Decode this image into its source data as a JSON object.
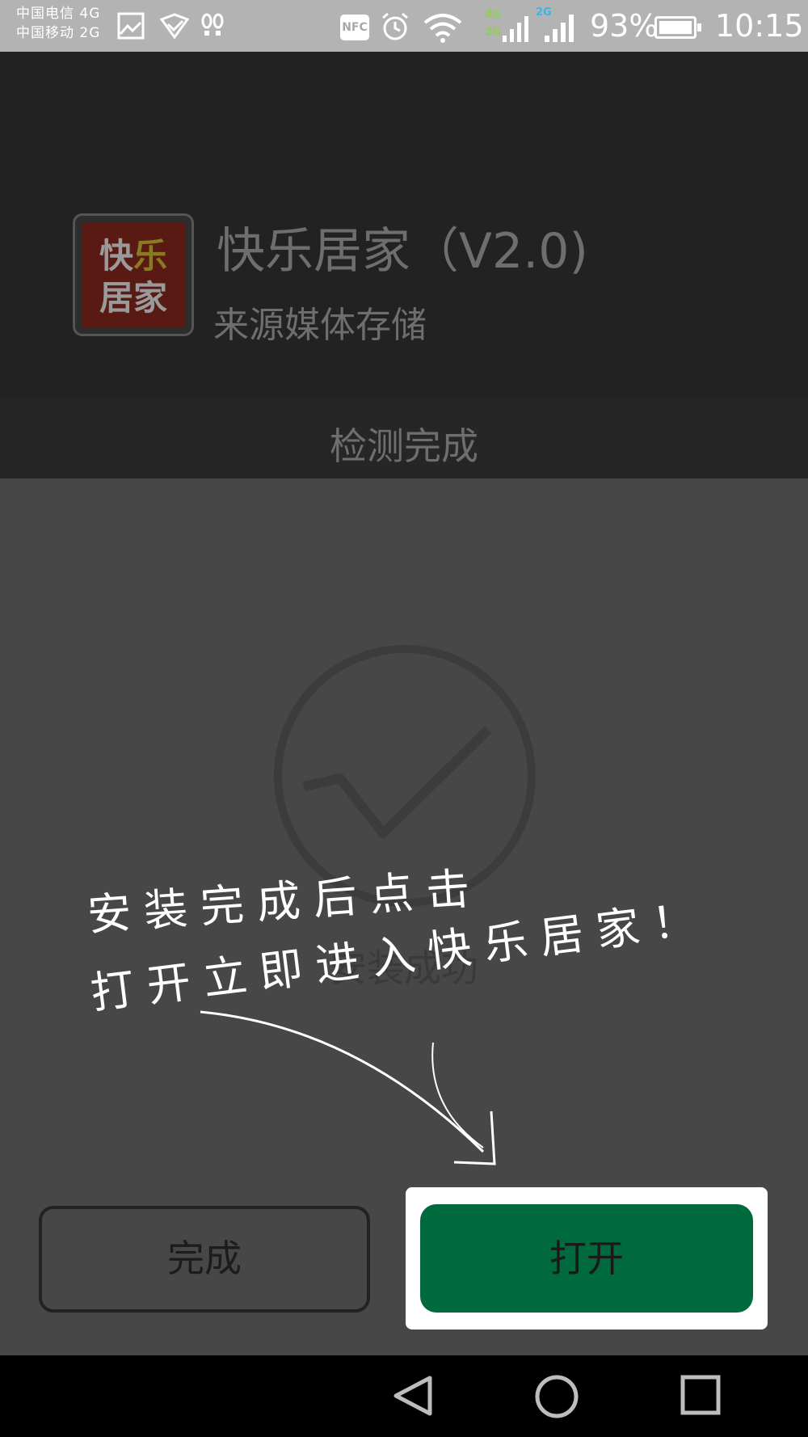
{
  "status_bar": {
    "carrier_1": "中国电信 4G",
    "carrier_2": "中国移动 2G",
    "nfc": "NFC",
    "net_4g": "4G",
    "net_2g_a": "2G",
    "net_2g_b": "2G",
    "battery_percent": "93%",
    "battery_level": 0.93,
    "time": "10:15",
    "icons": [
      "gallery-icon",
      "shield-icon",
      "footprints-icon",
      "nfc-icon",
      "alarm-icon",
      "wifi-icon",
      "signal-icon",
      "battery-icon"
    ]
  },
  "app": {
    "logo_text_line1": "快乐",
    "logo_text_line2": "居家",
    "name": "快乐居家（V2.0)",
    "source": "来源媒体存储"
  },
  "detection": {
    "status": "检测完成"
  },
  "result": {
    "icon": "checkmark-circle-icon",
    "text": "安装成功"
  },
  "hint": {
    "line1": "安装完成后点击",
    "line2": "打开立即进入快乐居家！"
  },
  "buttons": {
    "done": "完成",
    "open": "打开"
  },
  "colors": {
    "open_button": "#00693e",
    "status_bar": "#b3b3b3",
    "overlay": "#474747"
  },
  "nav": {
    "icons": [
      "back-icon",
      "home-icon",
      "recents-icon"
    ]
  }
}
